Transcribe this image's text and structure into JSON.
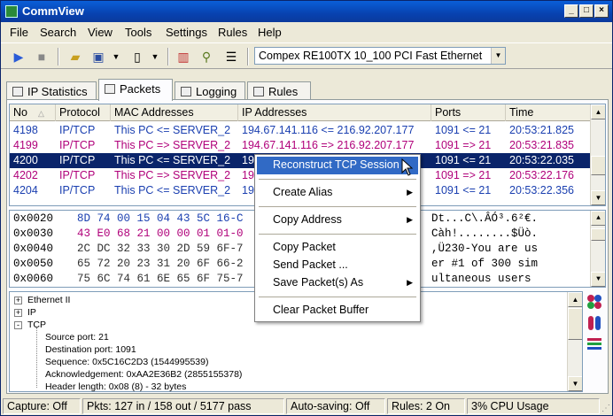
{
  "window": {
    "title": "CommView"
  },
  "menu": [
    "File",
    "Search",
    "View",
    "Tools",
    "Settings",
    "Rules",
    "Help"
  ],
  "toolbar": {
    "adapter": "Compex RE100TX 10_100 PCI Fast Ethernet"
  },
  "tabs": [
    {
      "label": "IP Statistics",
      "icon": "chart-icon"
    },
    {
      "label": "Packets",
      "icon": "packets-icon"
    },
    {
      "label": "Logging",
      "icon": "logging-icon"
    },
    {
      "label": "Rules",
      "icon": "rules-icon"
    }
  ],
  "active_tab": "Packets",
  "packet_table": {
    "columns": [
      "No",
      "Protocol",
      "MAC Addresses",
      "IP Addresses",
      "Ports",
      "Time"
    ],
    "rows": [
      {
        "no": "4198",
        "protocol": "IP/TCP",
        "mac": "This PC <= SERVER_2",
        "ip": "194.67.141.116 <= 216.92.207.177",
        "ports": "1091 <= 21",
        "time": "20:53:21.825",
        "color": "#1a3fb0"
      },
      {
        "no": "4199",
        "protocol": "IP/TCP",
        "mac": "This PC => SERVER_2",
        "ip": "194.67.141.116 => 216.92.207.177",
        "ports": "1091 => 21",
        "time": "20:53:21.835",
        "color": "#b0007a"
      },
      {
        "no": "4200",
        "protocol": "IP/TCP",
        "mac": "This PC <= SERVER_2",
        "ip": "19",
        "ports": "1091 <= 21",
        "time": "20:53:22.035",
        "color": "#1a3fb0",
        "selected": true
      },
      {
        "no": "4202",
        "protocol": "IP/TCP",
        "mac": "This PC => SERVER_2",
        "ip": "19",
        "ports": "1091 => 21",
        "time": "20:53:22.176",
        "color": "#b0007a"
      },
      {
        "no": "4204",
        "protocol": "IP/TCP",
        "mac": "This PC <= SERVER_2",
        "ip": "19",
        "ports": "1091 <= 21",
        "time": "20:53:22.356",
        "color": "#1a3fb0"
      }
    ]
  },
  "hex_dump": [
    {
      "offset": "0x0020",
      "bytes": "8D 74 00 15 04 43 5C 16-C",
      "ascii": "Dt...C\\.ÂÓ³.6²€."
    },
    {
      "offset": "0x0030",
      "bytes": "43 E0 68 21 00 00 01 01-0",
      "ascii": "Càh!........$Üò."
    },
    {
      "offset": "0x0040",
      "bytes": "2C DC 32 33 30 2D 59 6F-7",
      "ascii": ",Ü230-You are us"
    },
    {
      "offset": "0x0050",
      "bytes": "65 72 20 23 31 20 6F 66-2",
      "ascii": "er #1 of 300 sim"
    },
    {
      "offset": "0x0060",
      "bytes": "75 6C 74 61 6E 65 6F 75-7",
      "ascii": "ultaneous users"
    }
  ],
  "tree": {
    "top": [
      {
        "label": "Ethernet II",
        "expander": "+"
      },
      {
        "label": "IP",
        "expander": "+"
      },
      {
        "label": "TCP",
        "expander": "-"
      }
    ],
    "tcp_children": [
      "Source port: 21",
      "Destination port: 1091",
      "Sequence: 0x5C16C2D3 (1544995539)",
      "Acknowledgement: 0xAA2E36B2 (2855155378)",
      "Header length: 0x08 (8) - 32 bytes"
    ]
  },
  "context_menu": {
    "items": [
      {
        "label": "Reconstruct TCP Session",
        "highlighted": true
      },
      {
        "label": "Create Alias",
        "submenu": true
      },
      {
        "label": "Copy Address",
        "submenu": true
      },
      {
        "label": "Copy Packet"
      },
      {
        "label": "Send Packet ..."
      },
      {
        "label": "Save Packet(s) As",
        "submenu": true
      },
      {
        "label": "Clear Packet Buffer"
      }
    ]
  },
  "status": {
    "capture": "Capture: Off",
    "packets": "Pkts: 127 in / 158 out / 5177 pass",
    "autosave": "Auto-saving: Off",
    "rules": "Rules: 2 On",
    "cpu": "3% CPU Usage"
  }
}
